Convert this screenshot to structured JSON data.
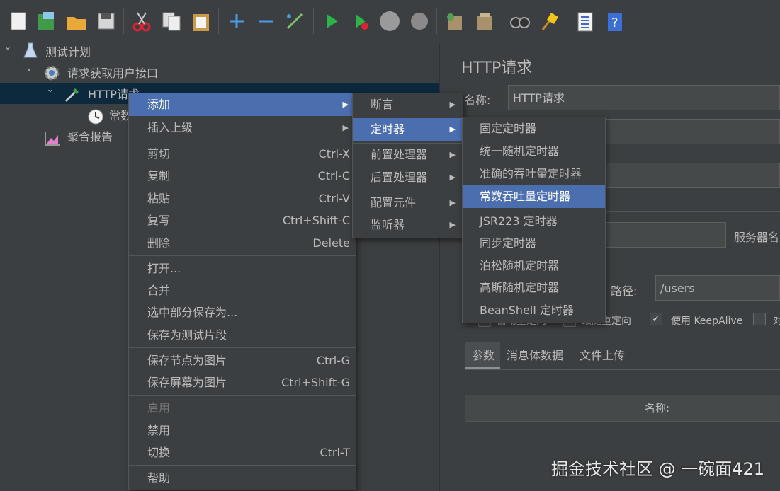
{
  "toolbar": {
    "buttons": [
      "new-icon",
      "templates-icon",
      "open-icon",
      "save-icon",
      "cut-icon",
      "copy-icon",
      "paste-icon",
      "expand-icon",
      "collapse-icon",
      "toggle-icon",
      "start-icon",
      "start-no-pause-icon",
      "stop-icon",
      "shutdown-icon",
      "clear-icon",
      "clear-all-icon",
      "search-icon",
      "reset-search-icon",
      "function-helper-icon",
      "help-icon"
    ]
  },
  "tree": {
    "test_plan": "测试计划",
    "thread_group": "请求获取用户接口",
    "http_request": "HTTP请求",
    "timer_child": "常数",
    "report": "聚合报告"
  },
  "right_panel": {
    "title": "HTTP请求",
    "name_label": "名称:",
    "name_value": "HTTP请求",
    "server_label": "服务器名",
    "path_label": "路径:",
    "path_value": "/users",
    "checkbox_auto_redirect": "自动重定向",
    "checkbox_follow_redirect": "跟随重定向",
    "checkbox_keepalive": "使用 KeepAlive",
    "checkbox_multipart": "对",
    "tabs": [
      "参数",
      "消息体数据",
      "文件上传"
    ],
    "table_header_name": "名称:"
  },
  "context_menu": {
    "items": [
      {
        "label": "添加",
        "shortcut": "",
        "submenu": true
      },
      {
        "label": "插入上级",
        "shortcut": "",
        "submenu": true
      },
      {
        "label": "剪切",
        "shortcut": "Ctrl-X"
      },
      {
        "label": "复制",
        "shortcut": "Ctrl-C"
      },
      {
        "label": "粘贴",
        "shortcut": "Ctrl-V"
      },
      {
        "label": "复写",
        "shortcut": "Ctrl+Shift-C"
      },
      {
        "label": "删除",
        "shortcut": "Delete"
      },
      {
        "label": "打开..."
      },
      {
        "label": "合并"
      },
      {
        "label": "选中部分保存为..."
      },
      {
        "label": "保存为测试片段"
      },
      {
        "label": "保存节点为图片",
        "shortcut": "Ctrl-G"
      },
      {
        "label": "保存屏幕为图片",
        "shortcut": "Ctrl+Shift-G"
      },
      {
        "label": "启用",
        "disabled": true
      },
      {
        "label": "禁用"
      },
      {
        "label": "切换",
        "shortcut": "Ctrl-T"
      },
      {
        "label": "帮助"
      }
    ]
  },
  "add_submenu": {
    "items": [
      "断言",
      "定时器",
      "前置处理器",
      "后置处理器",
      "配置元件",
      "监听器"
    ]
  },
  "timer_submenu": {
    "items": [
      "固定定时器",
      "统一随机定时器",
      "准确的吞吐量定时器",
      "常数吞吐量定时器",
      "JSR223 定时器",
      "同步定时器",
      "泊松随机定时器",
      "高斯随机定时器",
      "BeanShell 定时器"
    ]
  },
  "watermark": "掘金技术社区 @ 一碗面421",
  "colors": {
    "highlight": "#4b6eaf",
    "background": "#3c3f41",
    "selection": "#0d293e"
  }
}
